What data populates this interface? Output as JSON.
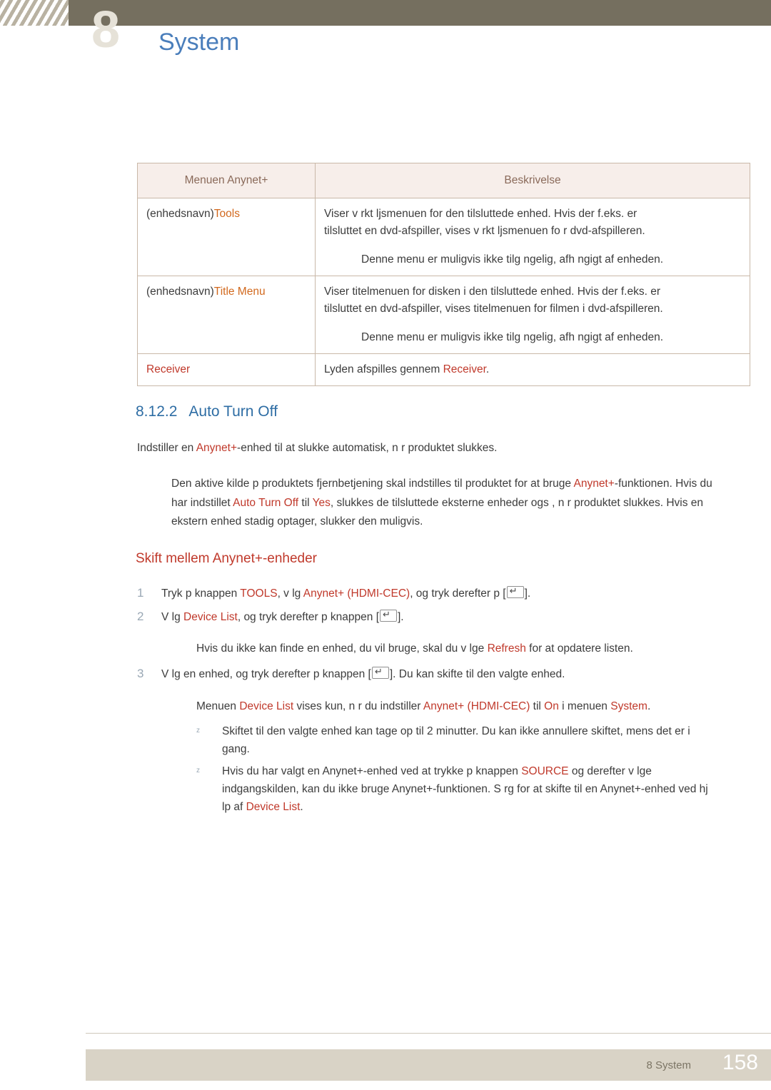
{
  "header": {
    "ghost_number": "8",
    "title": "System"
  },
  "table": {
    "headers": [
      "Menuen Anynet+",
      "Beskrivelse"
    ],
    "rows": [
      {
        "left_plain": "(enhedsnavn)",
        "left_kw": "Tools",
        "right_lines": [
          "Viser v rkt ljsmenuen for den tilsluttede enhed. Hvis der f.eks. er",
          "tilsluttet en dvd-afspiller, vises v rkt ljsmenuen fo r dvd-afspilleren."
        ],
        "right_sub": "Denne menu er muligvis ikke tilg ngelig, afh ngigt af enheden."
      },
      {
        "left_plain": "(enhedsnavn)",
        "left_kw": "Title Menu",
        "right_lines": [
          "Viser titelmenuen for disken i den tilsluttede enhed. Hvis der f.eks. er",
          "tilsluttet en dvd-afspiller, vises titelmenuen for filmen i dvd-afspilleren."
        ],
        "right_sub": "Denne menu er muligvis ikke tilg ngelig, afh ngigt af enheden."
      },
      {
        "left_kw_only": "Receiver",
        "right_pre": "Lyden afspilles gennem ",
        "right_kw": "Receiver",
        "right_post": "."
      }
    ]
  },
  "section": {
    "number": "8.12.2",
    "title": "Auto Turn Off",
    "intro_pre": "Indstiller en ",
    "intro_kw": "Anynet+",
    "intro_post": "-enhed til at slukke automatisk, n r produktet slukkes.",
    "para_parts": [
      "Den aktive kilde p  produktets fjernbetjening skal indstilles til produktet for at bruge ",
      "Anynet+",
      "-funktionen. Hvis du har indstillet ",
      "Auto Turn Off",
      " til ",
      "Yes",
      ", slukkes de tilsluttede eksterne enheder ogs , n r produktet slukkes. Hvis en ekstern enhed stadig optager, slukker den muligvis."
    ]
  },
  "subheading": "Skift mellem Anynet+-enheder",
  "steps": [
    {
      "n": "1",
      "pre": "Tryk p  knappen ",
      "kw1": "TOOLS",
      "mid": ", v lg ",
      "kw2": "Anynet+ (HDMI-CEC)",
      "post": ", og tryk derefter p  [",
      "end": "]."
    },
    {
      "n": "2",
      "pre": "V lg ",
      "kw1": "Device List",
      "post": ", og tryk derefter p  knappen [",
      "end": "]."
    },
    {
      "n": "3",
      "pre": "V lg en enhed, og tryk derefter p  knappen [",
      "post": "]. Du kan skifte til den valgte enhed."
    }
  ],
  "notes": {
    "note1_pre": "Hvis du ikke kan finde en enhed, du vil bruge, skal du v lge ",
    "note1_kw": "Refresh",
    "note1_post": " for at opdatere listen.",
    "note2_pre": "Menuen ",
    "note2_kw1": "Device List",
    "note2_mid1": " vises kun, n r du indstiller ",
    "note2_kw2": "Anynet+ (HDMI-CEC)",
    "note2_mid2": " til ",
    "note2_kw3": "On",
    "note2_mid3": " i menuen ",
    "note2_kw4": "System",
    "note2_post": "."
  },
  "bullets": [
    {
      "text": "Skiftet til den valgte enhed kan tage op til 2 minutter. Du kan ikke annullere skiftet, mens det er i gang."
    },
    {
      "pre": "Hvis du har valgt en Anynet+-enhed ved at trykke p  knappen ",
      "kw1": "SOURCE",
      "mid": " og derefter v lge indgangskilden, kan du ikke bruge Anynet+-funktionen. S rg for at skifte til en Anynet+-enhed ved hj lp af ",
      "kw2": "Device List",
      "post": "."
    }
  ],
  "footer": {
    "label": "8 System",
    "page": "158"
  }
}
